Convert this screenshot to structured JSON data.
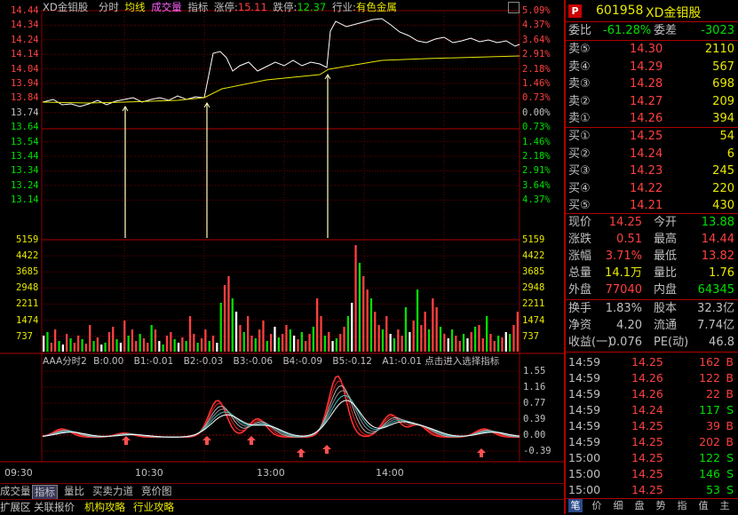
{
  "header": {
    "name": "XD金钼股",
    "menu": [
      "分时",
      "均线",
      "成交量",
      "指标"
    ],
    "limit_up_label": "涨停:",
    "limit_up_value": "15.11",
    "limit_down_label": "跌停:",
    "limit_down_value": "12.37",
    "industry_label": "行业:",
    "industry_value": "有色金属"
  },
  "price_axis_left": [
    "14.44",
    "14.34",
    "14.24",
    "14.14",
    "14.04",
    "13.94",
    "13.84",
    "13.74",
    "13.64",
    "13.54",
    "13.44",
    "13.34",
    "13.24",
    "13.14"
  ],
  "price_axis_right": [
    "5.09%",
    "4.37%",
    "3.64%",
    "2.91%",
    "2.18%",
    "1.46%",
    "0.73%",
    "0.00%",
    "0.73%",
    "1.46%",
    "2.18%",
    "2.91%",
    "3.64%",
    "4.37%"
  ],
  "volume_axis": [
    "5159",
    "4422",
    "3685",
    "2948",
    "2211",
    "1474",
    "737"
  ],
  "indicator_header": {
    "name": "AAA分时2",
    "values": [
      "B:0.00",
      "B1:-0.01",
      "B2:-0.03",
      "B3:-0.06",
      "B4:-0.09",
      "B5:-0.12",
      "A1:-0.01"
    ],
    "tail": "点击进入选择指标"
  },
  "indicator_axis": [
    "1.55",
    "1.16",
    "0.77",
    "0.39",
    "0.00",
    "-0.39"
  ],
  "time_axis": [
    "09:30",
    "10:30",
    "13:00",
    "14:00"
  ],
  "bottom_tabs_row1": [
    "成交量",
    "指标",
    "量比",
    "买卖力道",
    "竞价图"
  ],
  "bottom_tabs_row2": [
    "扩展区",
    "关联报价",
    "机构攻略",
    "行业攻略"
  ],
  "stock": {
    "code": "601958",
    "name": "XD金钼股",
    "badge": "P"
  },
  "weibi": {
    "label": "委比",
    "value": "-61.28%",
    "label2": "委差",
    "value2": "-3023"
  },
  "sell_orders": [
    {
      "label": "卖⑤",
      "price": "14.30",
      "volume": "2110"
    },
    {
      "label": "卖④",
      "price": "14.29",
      "volume": "567"
    },
    {
      "label": "卖③",
      "price": "14.28",
      "volume": "698"
    },
    {
      "label": "卖②",
      "price": "14.27",
      "volume": "209"
    },
    {
      "label": "卖①",
      "price": "14.26",
      "volume": "394"
    }
  ],
  "buy_orders": [
    {
      "label": "买①",
      "price": "14.25",
      "volume": "54"
    },
    {
      "label": "买②",
      "price": "14.24",
      "volume": "6"
    },
    {
      "label": "买③",
      "price": "14.23",
      "volume": "245"
    },
    {
      "label": "买④",
      "price": "14.22",
      "volume": "220"
    },
    {
      "label": "买⑤",
      "price": "14.21",
      "volume": "430"
    }
  ],
  "stats1": [
    {
      "l1": "现价",
      "v1": "14.25",
      "l2": "今开",
      "v2": "13.88",
      "c1": "#ff4040",
      "c2": "#00e000"
    },
    {
      "l1": "涨跌",
      "v1": "0.51",
      "l2": "最高",
      "v2": "14.44",
      "c1": "#ff4040",
      "c2": "#ff4040"
    },
    {
      "l1": "涨幅",
      "v1": "3.71%",
      "l2": "最低",
      "v2": "13.82",
      "c1": "#ff4040",
      "c2": "#ff4040"
    },
    {
      "l1": "总量",
      "v1": "14.1万",
      "l2": "量比",
      "v2": "1.76",
      "c1": "#e8e800",
      "c2": "#e8e800"
    },
    {
      "l1": "外盘",
      "v1": "77040",
      "l2": "内盘",
      "v2": "64345",
      "c1": "#ff4040",
      "c2": "#00e000"
    }
  ],
  "stats2": [
    {
      "l1": "换手",
      "v1": "1.83%",
      "l2": "股本",
      "v2": "32.3亿"
    },
    {
      "l1": "净资",
      "v1": "4.20",
      "l2": "流通",
      "v2": "7.74亿"
    },
    {
      "l1": "收益(一)",
      "v1": "0.076",
      "l2": "PE(动)",
      "v2": "46.8"
    }
  ],
  "ticks": [
    {
      "time": "14:59",
      "price": "14.25",
      "vol": "162",
      "side": "B"
    },
    {
      "time": "14:59",
      "price": "14.26",
      "vol": "122",
      "side": "B"
    },
    {
      "time": "14:59",
      "price": "14.26",
      "vol": "22",
      "side": "B"
    },
    {
      "time": "14:59",
      "price": "14.24",
      "vol": "117",
      "side": "S"
    },
    {
      "time": "14:59",
      "price": "14.25",
      "vol": "39",
      "side": "B"
    },
    {
      "time": "14:59",
      "price": "14.25",
      "vol": "202",
      "side": "B"
    },
    {
      "time": "15:00",
      "price": "14.25",
      "vol": "122",
      "side": "S"
    },
    {
      "time": "15:00",
      "price": "14.25",
      "vol": "146",
      "side": "S"
    },
    {
      "time": "15:00",
      "price": "14.25",
      "vol": "53",
      "side": "S"
    }
  ],
  "right_tabs": [
    "笔",
    "价",
    "细",
    "盘",
    "势",
    "指",
    "值",
    "主"
  ],
  "colors": {
    "up": "#ff4040",
    "down": "#00e000",
    "grid": "#8b0000",
    "text": "#c0c0c0",
    "price_line": "#ffffff",
    "avg_line": "#e8e800",
    "border": "#b00000"
  }
}
